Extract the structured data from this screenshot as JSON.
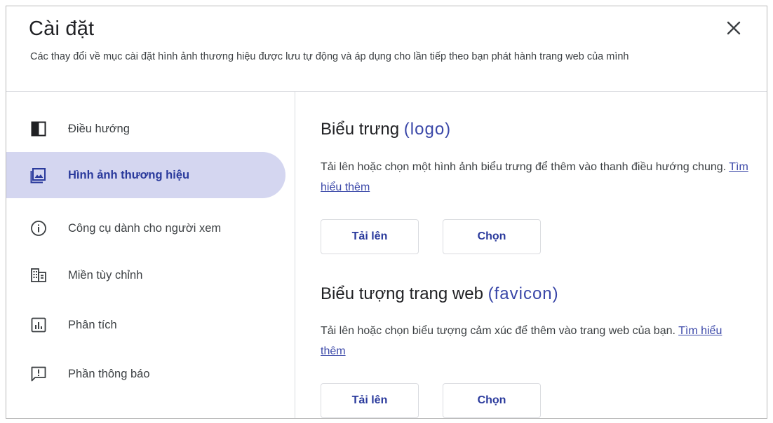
{
  "dialog": {
    "title": "Cài đặt",
    "subtitle": "Các thay đổi về mục cài đặt hình ảnh thương hiệu được lưu tự động và áp dụng cho lần tiếp theo bạn phát hành trang web của mình",
    "close_icon": "close-icon"
  },
  "sidebar": {
    "items": [
      {
        "label": "Điều hướng",
        "icon": "navigation-icon",
        "active": false
      },
      {
        "label": "Hình ảnh thương hiệu",
        "icon": "brand-image-icon",
        "active": true
      },
      {
        "label": "Công cụ dành cho người xem",
        "icon": "info-icon",
        "active": false
      },
      {
        "label": "Miền tùy chỉnh",
        "icon": "domain-icon",
        "active": false
      },
      {
        "label": "Phân tích",
        "icon": "analytics-icon",
        "active": false
      },
      {
        "label": "Phần thông báo",
        "icon": "announcement-icon",
        "active": false
      }
    ]
  },
  "logo_section": {
    "title": "Biểu trưng",
    "title_accent": "(logo)",
    "description": "Tải lên hoặc chọn một hình ảnh biểu trưng để thêm vào thanh điều hướng chung.",
    "learn_more": "Tìm hiểu thêm",
    "upload_label": "Tải lên",
    "select_label": "Chọn"
  },
  "favicon_section": {
    "title": "Biểu tượng trang web",
    "title_accent": "(favicon)",
    "description": "Tải lên hoặc chọn biểu tượng cảm xúc để thêm vào trang web của bạn.",
    "learn_more": "Tìm hiểu thêm",
    "upload_label": "Tải lên",
    "select_label": "Chọn"
  },
  "colors": {
    "accent": "#3a47a8",
    "active_nav_bg": "#d4d6f0",
    "border": "#dadce0"
  }
}
